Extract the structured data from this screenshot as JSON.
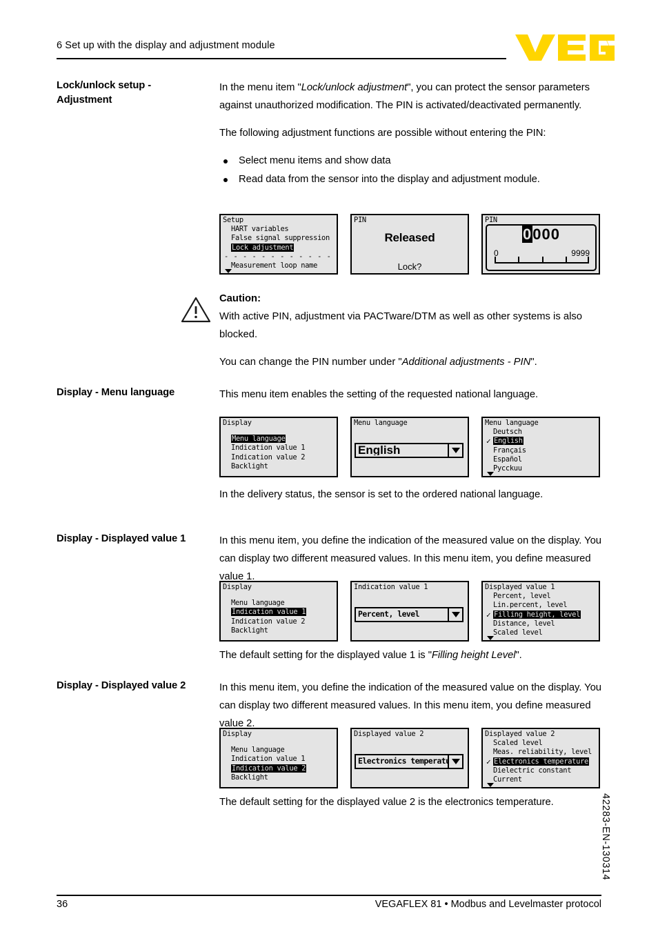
{
  "header": {
    "chapter_title": "6 Set up with the display and adjustment module",
    "logo_text": "VEGA",
    "logo_color": "#FFD500"
  },
  "footer": {
    "page_number": "36",
    "document_title": "VEGAFLEX 81 • Modbus and Levelmaster protocol",
    "side_code": "42283-EN-130314"
  },
  "sections": {
    "lock_unlock": {
      "label": "Lock/unlock setup - Adjustment",
      "para1_pre": "In the menu item \"",
      "para1_it": "Lock/unlock adjustment",
      "para1_post": "\", you can protect the sensor parameters against unauthorized modification. The PIN is activated/deactivated permanently.",
      "para2": "The following adjustment functions are possible without entering the PIN:",
      "bullets": [
        "Select menu items and show data",
        "Read data from the sensor into the display and adjustment module."
      ]
    },
    "caution": {
      "title": "Caution:",
      "para1": "With active PIN, adjustment via PACTware/DTM as well as other systems is also blocked.",
      "para2_pre": "You can change the PIN number under \"",
      "para2_it": "Additional adjustments - PIN",
      "para2_post": "\".",
      "icon": "warning-triangle-icon"
    },
    "menu_language": {
      "label": "Display - Menu language",
      "para1": "This menu item enables the setting of the requested national language.",
      "para2": "In the delivery status, the sensor is set to the ordered national language."
    },
    "displayed_value_1": {
      "label": "Display - Displayed value 1",
      "para1": "In this menu item, you define the indication of the measured value on the display. You can display two different measured values. In this menu item, you define measured value 1.",
      "para2_pre": "The default setting for the displayed value 1 is \"",
      "para2_it": "Filling height Level",
      "para2_post": "\"."
    },
    "displayed_value_2": {
      "label": "Display - Displayed value 2",
      "para1": "In this menu item, you define the indication of the measured value on the display. You can display two different measured values. In this menu item, you define measured value 2.",
      "para2": "The default setting for the displayed value 2 is the electronics temperature."
    }
  },
  "lcd_rows": {
    "row_lock": [
      {
        "type": "list",
        "title": "Setup",
        "items": [
          {
            "text": "HART variables",
            "selected": false,
            "check": false
          },
          {
            "text": "False signal suppression",
            "selected": false,
            "check": false
          },
          {
            "text": "Lock adjustment",
            "selected": true,
            "check": false
          }
        ],
        "divider": "- - - - - - - - - - - - - - - - - - - -",
        "items_after": [
          {
            "text": "Measurement loop name",
            "selected": false,
            "check": false
          }
        ],
        "scroll_down": true
      },
      {
        "type": "status",
        "title": "PIN",
        "center_text": "Released",
        "bottom_text": "Lock?"
      },
      {
        "type": "numeric",
        "title": "PIN",
        "digits_active": "0",
        "digits_rest": "000",
        "scale_min": "0",
        "scale_max": "9999"
      }
    ],
    "row_language": [
      {
        "type": "list",
        "title": "Display",
        "leading_gap": true,
        "items": [
          {
            "text": "Menu language",
            "selected": true,
            "check": false
          },
          {
            "text": "Indication value 1",
            "selected": false,
            "check": false
          },
          {
            "text": "Indication value 2",
            "selected": false,
            "check": false
          },
          {
            "text": "Backlight",
            "selected": false,
            "check": false
          }
        ]
      },
      {
        "type": "dropdown",
        "title": "Menu language",
        "value": "English",
        "big": true
      },
      {
        "type": "list",
        "title": "Menu language",
        "items": [
          {
            "text": "Deutsch",
            "selected": false,
            "check": false
          },
          {
            "text": "English",
            "selected": true,
            "check": true
          },
          {
            "text": "Français",
            "selected": false,
            "check": false
          },
          {
            "text": "Español",
            "selected": false,
            "check": false
          },
          {
            "text": "Pycckuu",
            "selected": false,
            "check": false
          }
        ],
        "scroll_down": true
      }
    ],
    "row_value1": [
      {
        "type": "list",
        "title": "Display",
        "leading_gap": true,
        "items": [
          {
            "text": "Menu language",
            "selected": false,
            "check": false
          },
          {
            "text": "Indication value 1",
            "selected": true,
            "check": false
          },
          {
            "text": "Indication value 2",
            "selected": false,
            "check": false
          },
          {
            "text": "Backlight",
            "selected": false,
            "check": false
          }
        ]
      },
      {
        "type": "dropdown",
        "title": "Indication value 1",
        "value": "Percent, level",
        "big": false
      },
      {
        "type": "list",
        "title": "Displayed value 1",
        "items": [
          {
            "text": "Percent, level",
            "selected": false,
            "check": false
          },
          {
            "text": "Lin.percent, level",
            "selected": false,
            "check": false
          },
          {
            "text": "Filling height, level",
            "selected": true,
            "check": true
          },
          {
            "text": "Distance, level",
            "selected": false,
            "check": false
          },
          {
            "text": "Scaled level",
            "selected": false,
            "check": false
          }
        ],
        "scroll_down": true
      }
    ],
    "row_value2": [
      {
        "type": "list",
        "title": "Display",
        "leading_gap": true,
        "items": [
          {
            "text": "Menu language",
            "selected": false,
            "check": false
          },
          {
            "text": "Indication value 1",
            "selected": false,
            "check": false
          },
          {
            "text": "Indication value 2",
            "selected": true,
            "check": false
          },
          {
            "text": "Backlight",
            "selected": false,
            "check": false
          }
        ]
      },
      {
        "type": "dropdown",
        "title": "Displayed value 2",
        "value": "Electronics temperature",
        "big": false
      },
      {
        "type": "list",
        "title": "Displayed value 2",
        "items": [
          {
            "text": "Scaled level",
            "selected": false,
            "check": false
          },
          {
            "text": "Meas. reliability, level",
            "selected": false,
            "check": false
          },
          {
            "text": "Electronics temperature",
            "selected": true,
            "check": true
          },
          {
            "text": "Dielectric constant",
            "selected": false,
            "check": false
          },
          {
            "text": "Current",
            "selected": false,
            "check": false
          }
        ],
        "scroll_down": true
      }
    ]
  }
}
